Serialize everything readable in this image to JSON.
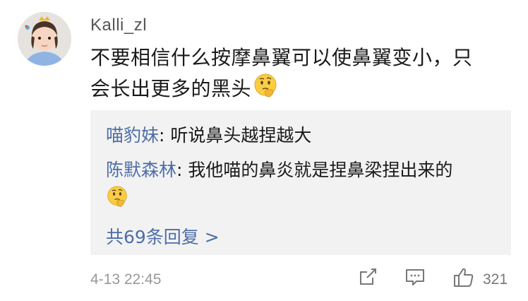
{
  "post": {
    "username": "Kalli_zl",
    "text_line1": "不要相信什么按摩鼻翼可以使鼻翼变小，只",
    "text_line2": "会长出更多的黑头"
  },
  "replies": [
    {
      "author": "喵豹妹",
      "separator": ": ",
      "text": "听说鼻头越捏越大"
    },
    {
      "author": "陈默森林",
      "separator": ": ",
      "text": "我他喵的鼻炎就是捏鼻梁捏出来的"
    }
  ],
  "more_replies": "共69条回复 >",
  "footer": {
    "timestamp": "4-13 22:45",
    "like_count": "321"
  },
  "icons": {
    "emoji": "thinking-face-icon",
    "share": "share-icon",
    "comment": "comment-icon",
    "like": "thumbs-up-icon"
  },
  "colors": {
    "link": "#4e6ea8",
    "reply_bg": "#f2f2f2",
    "meta": "#999999"
  }
}
